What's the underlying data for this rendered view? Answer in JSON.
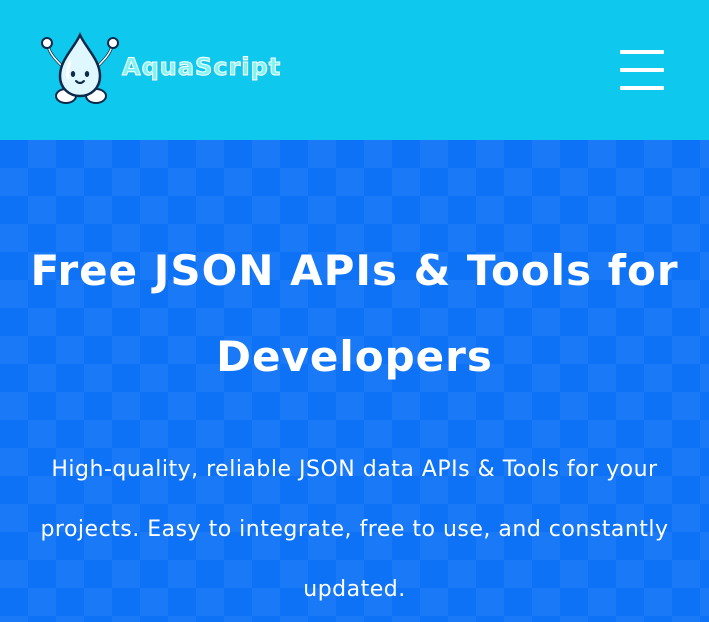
{
  "header": {
    "brand_name": "AquaScript",
    "logo_icon": "water-drop-mascot-icon",
    "menu_icon": "hamburger-menu-icon",
    "background_color": "#0fc8ee"
  },
  "hero": {
    "title": "Free JSON APIs & Tools for Developers",
    "subtitle": "High-quality, reliable JSON data APIs & Tools for your projects. Easy to integrate, free to use, and constantly updated.",
    "background_color": "#0d72f5"
  }
}
